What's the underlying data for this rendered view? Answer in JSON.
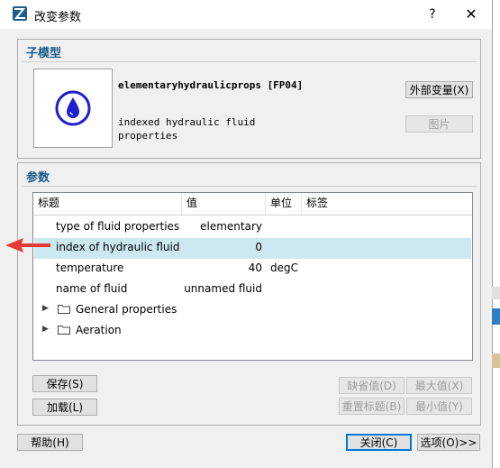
{
  "window": {
    "title": "改变参数",
    "help_label": "?",
    "close_label": "✕"
  },
  "submodel": {
    "group_title": "子模型",
    "name": "elementaryhydraulicprops [FP04]",
    "description_line1": "indexed hydraulic fluid",
    "description_line2": "properties",
    "external_vars_button": "外部变量(X)",
    "image_button": "图片"
  },
  "params": {
    "group_title": "参数",
    "columns": [
      "标题",
      "值",
      "单位",
      "标签"
    ],
    "rows": [
      {
        "title": "type of fluid properties",
        "value": "elementary",
        "unit": "",
        "tag": ""
      },
      {
        "title": "index of hydraulic fluid",
        "value": "0",
        "unit": "",
        "tag": ""
      },
      {
        "title": "temperature",
        "value": "40",
        "unit": "degC",
        "tag": ""
      },
      {
        "title": "name of fluid",
        "value": "unnamed fluid",
        "unit": "",
        "tag": ""
      }
    ],
    "folders": [
      {
        "label": "General properties"
      },
      {
        "label": "Aeration"
      }
    ],
    "selected_row_index": 1
  },
  "buttons": {
    "save": "保存(S)",
    "load": "加载(L)",
    "default_value": "缺省值(D)",
    "max_value": "最大值(X)",
    "reset_title": "重置标题(B)",
    "min_value": "最小值(Y)",
    "help": "帮助(H)",
    "close": "关闭(C)",
    "options": "选项(O)>>"
  },
  "colors": {
    "accent": "#1a5b8a",
    "selection": "#cce8f0",
    "arrow": "#e53935",
    "drop_icon": "#1f1fcf"
  },
  "icons": {
    "drop": "water-drop-icon",
    "folder": "folder-icon",
    "expand": "expand-arrow-icon"
  }
}
